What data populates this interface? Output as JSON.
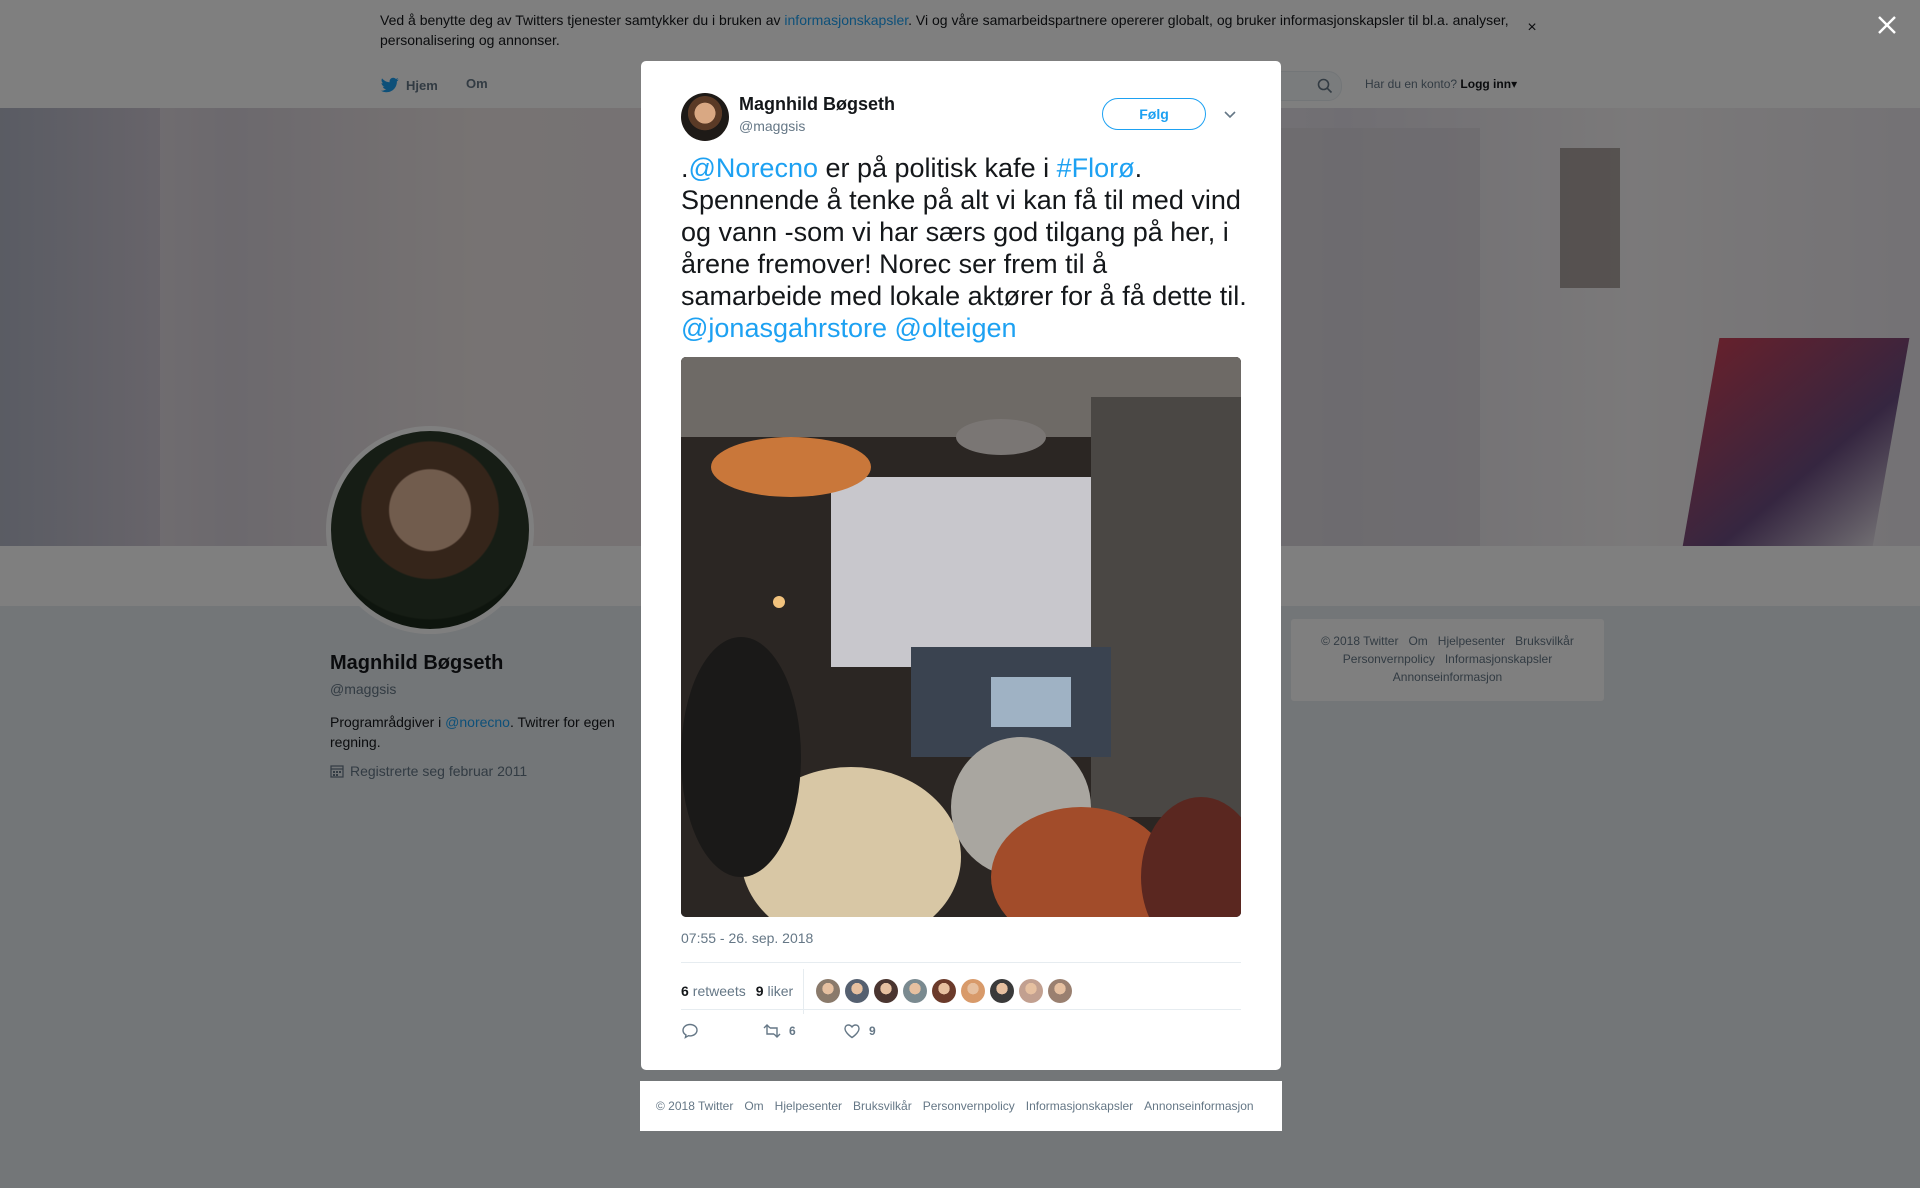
{
  "cookie_bar": {
    "text_before": "Ved å benytte deg av Twitters tjenester samtykker du i bruken av ",
    "link": "informasjonskapsler",
    "text_after": ". Vi og våre samarbeidspartnere opererer globalt, og bruker informasjonskapsler til bl.a. analyser, personalisering og annonser.",
    "close": "×"
  },
  "nav": {
    "home": "Hjem",
    "about": "Om",
    "login_prompt": "Har du en konto?",
    "login": "Logg inn",
    "login_caret": "▾"
  },
  "profile": {
    "name": "Magnhild Bøgseth",
    "handle": "@maggsis",
    "bio_before": "Programrådgiver i ",
    "bio_link": "@norecno",
    "bio_after": ". Twitrer for egen regning.",
    "joined": "Registrerte seg februar 2011"
  },
  "side_footer": [
    "© 2018 Twitter",
    "Om",
    "Hjelpesenter",
    "Bruksvilkår",
    "Personvernpolicy",
    "Informasjonskapsler",
    "Annonseinformasjon"
  ],
  "tweet": {
    "author_name": "Magnhild Bøgseth",
    "author_handle": "@maggsis",
    "follow_label": "Følg",
    "text": {
      "p1": ".",
      "mention1": "@Norecno",
      "p2": " er på politisk kafe i ",
      "hashtag": "#Florø",
      "p3": ". Spennende å tenke på alt vi kan få til med vind og vann -som vi har særs god tilgang på her, i årene fremover! Norec ser frem til å samarbeide med lokale aktører for å få dette til. ",
      "mention2": "@jonasgahrstore",
      "p4": " ",
      "mention3": "@olteigen"
    },
    "timestamp": "07:55 - 26. sep. 2018",
    "retweets_count": "6",
    "retweets_label": "retweets",
    "likes_count": "9",
    "likes_label": "liker",
    "liker_colors": [
      "#8a7a6b",
      "#556070",
      "#4a3530",
      "#7a8a90",
      "#6b3a2a",
      "#d89a6a",
      "#3a3a3a",
      "#c2a090",
      "#9a8070"
    ],
    "reply_count": "",
    "retweet_action_count": "6",
    "like_action_count": "9"
  },
  "modal_footer": [
    "© 2018 Twitter",
    "Om",
    "Hjelpesenter",
    "Bruksvilkår",
    "Personvernpolicy",
    "Informasjonskapsler",
    "Annonseinformasjon"
  ],
  "colors": {
    "accent": "#1da1f2",
    "text": "#14171a",
    "muted": "#657786",
    "overlay": "rgba(0,0,0,0.5)"
  }
}
